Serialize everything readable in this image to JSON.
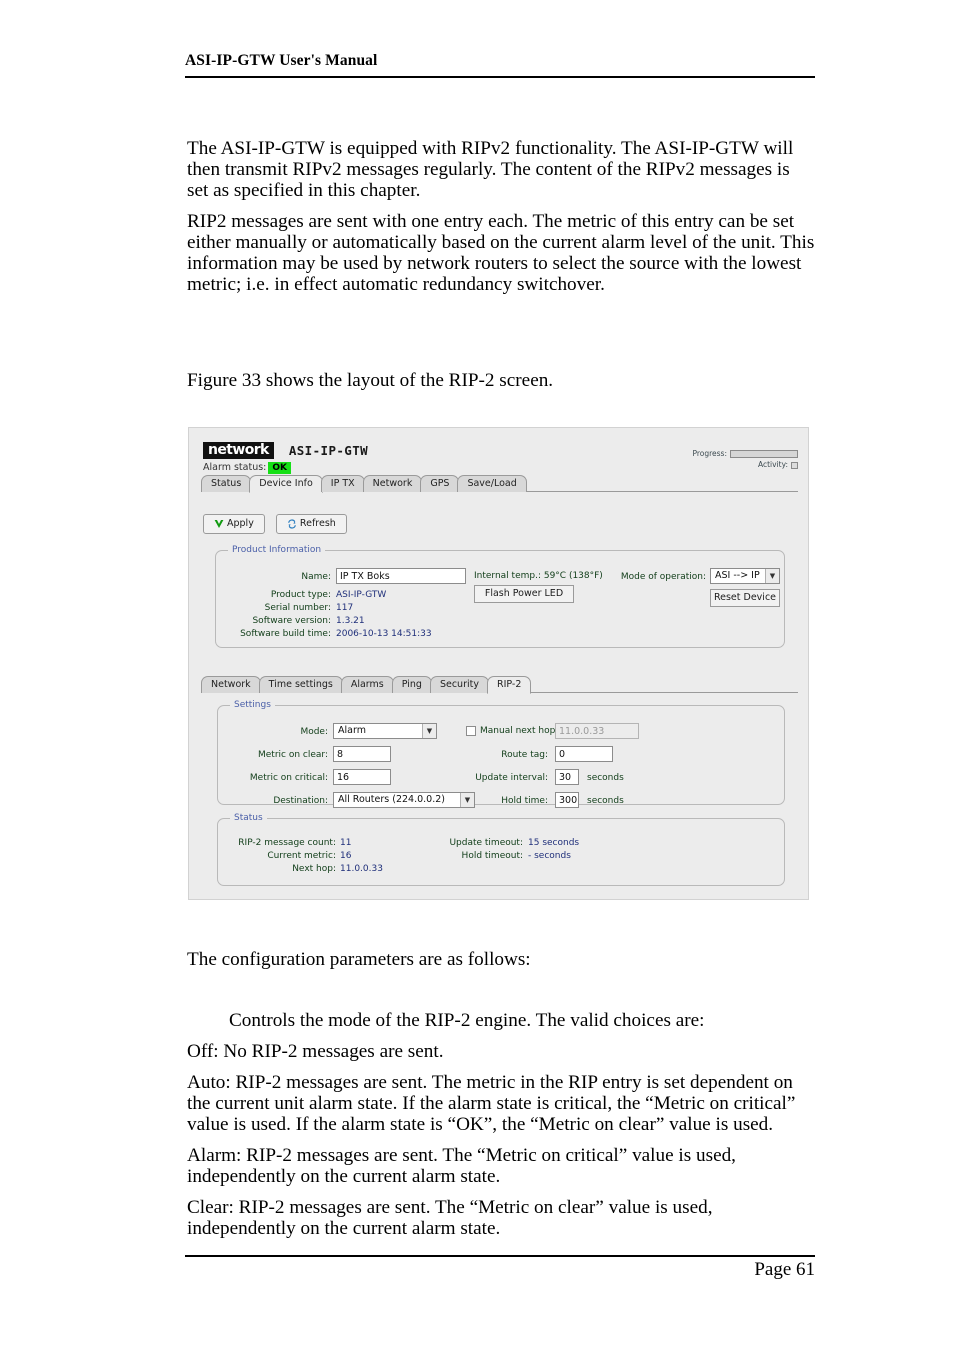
{
  "document": {
    "running_head": "ASI-IP-GTW User's Manual",
    "page_number": "Page 61"
  },
  "body": {
    "intro": [
      "The ASI-IP-GTW is equipped with RIPv2 functionality. The ASI-IP-GTW will then transmit RIPv2 messages regularly. The content of the RIPv2 messages is set as specified in this chapter.",
      "RIP2 messages are sent with one entry each. The metric of this entry can be set either manually or automatically based on the current alarm level of the unit. This information may be used by network routers to select the source with the lowest metric; i.e. in effect automatic redundancy switchover."
    ],
    "figure_caption_line": "Figure 33 shows the layout of the RIP-2 screen.",
    "config_line": "The configuration parameters are as follows:",
    "choices": [
      "Controls the mode of the RIP-2 engine. The valid choices are:",
      "Off: No RIP-2 messages are sent.",
      "Auto: RIP-2 messages are sent. The metric in the RIP entry is set dependent on the current unit alarm state. If the alarm state is critical, the “Metric on critical” value is used. If the alarm state is “OK”, the “Metric on clear” value is used.",
      "Alarm: RIP-2 messages are sent. The “Metric on critical” value is used, independently on the current alarm state.",
      "Clear: RIP-2 messages are sent. The “Metric on clear” value is used, independently on the current alarm state."
    ]
  },
  "figure": {
    "header": {
      "logo_text": "network",
      "device_title": "ASI-IP-GTW",
      "alarm_status_label": "Alarm status:",
      "alarm_status_value": "OK",
      "alarm_status_color": "#16e016",
      "progress_label": "Progress:",
      "activity_label": "Activity:"
    },
    "main_tabs": [
      {
        "label": "Status",
        "active": false
      },
      {
        "label": "Device Info",
        "active": true
      },
      {
        "label": "IP TX",
        "active": false
      },
      {
        "label": "Network",
        "active": false
      },
      {
        "label": "GPS",
        "active": false
      },
      {
        "label": "Save/Load",
        "active": false
      }
    ],
    "toolbar": {
      "apply_label": "Apply",
      "refresh_label": "Refresh"
    },
    "product_information": {
      "title": "Product Information",
      "name_label": "Name:",
      "name_value": "IP TX Boks",
      "rows": [
        {
          "label": "Product type:",
          "value": "ASI-IP-GTW"
        },
        {
          "label": "Serial number:",
          "value": "117"
        },
        {
          "label": "Software version:",
          "value": "1.3.21"
        },
        {
          "label": "Software build time:",
          "value": "2006-10-13 14:51:33"
        }
      ],
      "internal_temp": "Internal temp.: 59°C (138°F)",
      "flash_power_led_label": "Flash Power LED",
      "mode_of_operation_label": "Mode of operation:",
      "mode_of_operation_value": "ASI --> IP",
      "reset_device_label": "Reset Device"
    },
    "sub_tabs": [
      {
        "label": "Network",
        "active": false
      },
      {
        "label": "Time settings",
        "active": false
      },
      {
        "label": "Alarms",
        "active": false
      },
      {
        "label": "Ping",
        "active": false
      },
      {
        "label": "Security",
        "active": false
      },
      {
        "label": "RIP-2",
        "active": true
      }
    ],
    "settings": {
      "title": "Settings",
      "mode_label": "Mode:",
      "mode_value": "Alarm",
      "metric_on_clear_label": "Metric on clear:",
      "metric_on_clear_value": "8",
      "metric_on_critical_label": "Metric on critical:",
      "metric_on_critical_value": "16",
      "destination_label": "Destination:",
      "destination_value": "All Routers (224.0.0.2)",
      "manual_next_hop_label": "Manual next hop",
      "manual_next_hop_checked": false,
      "manual_next_hop_value": "11.0.0.33",
      "route_tag_label": "Route tag:",
      "route_tag_value": "0",
      "update_interval_label": "Update interval:",
      "update_interval_value": "30",
      "update_interval_unit": "seconds",
      "hold_time_label": "Hold time:",
      "hold_time_value": "300",
      "hold_time_unit": "seconds"
    },
    "status": {
      "title": "Status",
      "left": [
        {
          "label": "RIP-2 message count:",
          "value": "11"
        },
        {
          "label": "Current metric:",
          "value": "16"
        },
        {
          "label": "Next hop:",
          "value": "11.0.0.33"
        }
      ],
      "right": [
        {
          "label": "Update timeout:",
          "value": "15 seconds"
        },
        {
          "label": "Hold timeout:",
          "value": "- seconds"
        }
      ]
    }
  }
}
